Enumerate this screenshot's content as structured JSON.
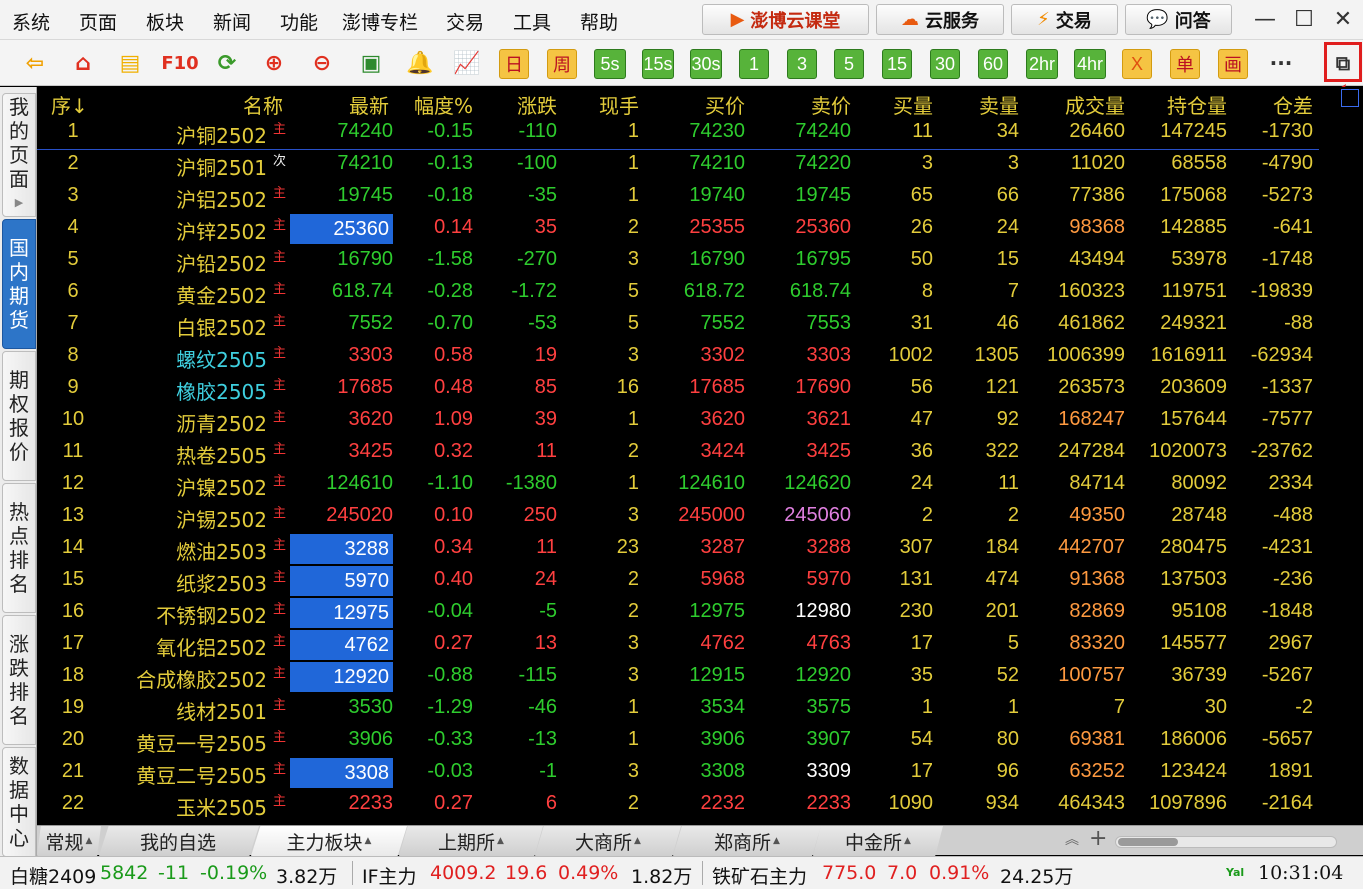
{
  "menu": [
    "系统",
    "页面",
    "板块",
    "新闻",
    "功能",
    "澎博专栏",
    "交易",
    "工具",
    "帮助"
  ],
  "top_buttons": [
    {
      "label": "澎博云课堂",
      "icon": "broadcast-icon"
    },
    {
      "label": "云服务",
      "icon": "cloud-icon"
    },
    {
      "label": "交易",
      "icon": "lightning-icon"
    },
    {
      "label": "问答",
      "icon": "chat-icon"
    }
  ],
  "window_controls": [
    "—",
    "☐",
    "✕"
  ],
  "toolbar": {
    "icons": [
      {
        "name": "back-arrow-icon",
        "glyph": "⇦",
        "color": "#f0a000"
      },
      {
        "name": "home-icon",
        "glyph": "⌂",
        "color": "#e03020"
      },
      {
        "name": "news-icon",
        "glyph": "▤",
        "color": "#f0b000"
      },
      {
        "name": "f10-icon",
        "glyph": "F10",
        "color": "#e03020"
      },
      {
        "name": "refresh-icon",
        "glyph": "⟳",
        "color": "#3a9a2a"
      },
      {
        "name": "zoom-in-icon",
        "glyph": "⊕",
        "color": "#e03020"
      },
      {
        "name": "zoom-out-icon",
        "glyph": "⊖",
        "color": "#e03020"
      },
      {
        "name": "windows-icon",
        "glyph": "▣",
        "color": "#2d8a2d"
      },
      {
        "name": "bell-icon",
        "glyph": "🔔",
        "color": "#f0a000"
      },
      {
        "name": "chart-up-icon",
        "glyph": "📈",
        "color": "#e03020"
      }
    ],
    "periods": [
      {
        "label": "日",
        "style": "yellow"
      },
      {
        "label": "周",
        "style": "yellow"
      },
      {
        "label": "5s",
        "style": "green"
      },
      {
        "label": "15s",
        "style": "green"
      },
      {
        "label": "30s",
        "style": "green"
      },
      {
        "label": "1",
        "style": "green"
      },
      {
        "label": "3",
        "style": "green"
      },
      {
        "label": "5",
        "style": "green"
      },
      {
        "label": "15",
        "style": "green"
      },
      {
        "label": "30",
        "style": "green"
      },
      {
        "label": "60",
        "style": "green"
      },
      {
        "label": "2hr",
        "style": "green"
      },
      {
        "label": "4hr",
        "style": "green"
      },
      {
        "label": "X",
        "style": "yellow"
      },
      {
        "label": "单",
        "style": "yellow"
      },
      {
        "label": "画",
        "style": "yellow"
      }
    ],
    "more": "···",
    "restore_icon": "restore-window-icon"
  },
  "sidebar_tabs": [
    {
      "label": "我的页面",
      "active": false,
      "arrow": true
    },
    {
      "label": "国内期货",
      "active": true,
      "arrow": false
    },
    {
      "label": "期权报价",
      "active": false,
      "arrow": false
    },
    {
      "label": "热点排名",
      "active": false,
      "arrow": false
    },
    {
      "label": "涨跌排名",
      "active": false,
      "arrow": false
    },
    {
      "label": "数据中心",
      "active": false,
      "arrow": false
    }
  ],
  "table": {
    "headers": [
      "序↓",
      "名称",
      "最新",
      "幅度%",
      "涨跌",
      "现手",
      "买价",
      "卖价",
      "买量",
      "卖量",
      "成交量",
      "持仓量",
      "仓差"
    ],
    "rows": [
      {
        "no": "1",
        "name": "沪铜2502",
        "tag": "主",
        "last": "74240",
        "pct": "-0.15",
        "chg": "-110",
        "hand": "1",
        "bid": "74230",
        "ask": "74240",
        "bidv": "11",
        "askv": "34",
        "vol": "26460",
        "oi": "147245",
        "oichg": "-1730",
        "dir": "down",
        "hl": false,
        "namec": "#e3cc3b",
        "askc": "#2ecc2e",
        "volc": "#e3cc3b"
      },
      {
        "no": "2",
        "name": "沪铜2501",
        "tag": "次",
        "last": "74210",
        "pct": "-0.13",
        "chg": "-100",
        "hand": "1",
        "bid": "74210",
        "ask": "74220",
        "bidv": "3",
        "askv": "3",
        "vol": "11020",
        "oi": "68558",
        "oichg": "-4790",
        "dir": "down",
        "hl": false,
        "namec": "#e3cc3b",
        "askc": "#2ecc2e",
        "volc": "#e3cc3b"
      },
      {
        "no": "3",
        "name": "沪铝2502",
        "tag": "主",
        "last": "19745",
        "pct": "-0.18",
        "chg": "-35",
        "hand": "1",
        "bid": "19740",
        "ask": "19745",
        "bidv": "65",
        "askv": "66",
        "vol": "77386",
        "oi": "175068",
        "oichg": "-5273",
        "dir": "down",
        "hl": false,
        "namec": "#e3cc3b",
        "askc": "#2ecc2e",
        "volc": "#e3cc3b"
      },
      {
        "no": "4",
        "name": "沪锌2502",
        "tag": "主",
        "last": "25360",
        "pct": "0.14",
        "chg": "35",
        "hand": "2",
        "bid": "25355",
        "ask": "25360",
        "bidv": "26",
        "askv": "24",
        "vol": "98368",
        "oi": "142885",
        "oichg": "-641",
        "dir": "up",
        "hl": true,
        "namec": "#e3cc3b",
        "askc": "#ff4040",
        "volc": "#ff9a40"
      },
      {
        "no": "5",
        "name": "沪铅2502",
        "tag": "主",
        "last": "16790",
        "pct": "-1.58",
        "chg": "-270",
        "hand": "3",
        "bid": "16790",
        "ask": "16795",
        "bidv": "50",
        "askv": "15",
        "vol": "43494",
        "oi": "53978",
        "oichg": "-1748",
        "dir": "down",
        "hl": false,
        "namec": "#e3cc3b",
        "askc": "#2ecc2e",
        "volc": "#e3cc3b"
      },
      {
        "no": "6",
        "name": "黄金2502",
        "tag": "主",
        "last": "618.74",
        "pct": "-0.28",
        "chg": "-1.72",
        "hand": "5",
        "bid": "618.72",
        "ask": "618.74",
        "bidv": "8",
        "askv": "7",
        "vol": "160323",
        "oi": "119751",
        "oichg": "-19839",
        "dir": "down",
        "hl": false,
        "namec": "#e3cc3b",
        "askc": "#2ecc2e",
        "volc": "#e3cc3b"
      },
      {
        "no": "7",
        "name": "白银2502",
        "tag": "主",
        "last": "7552",
        "pct": "-0.70",
        "chg": "-53",
        "hand": "5",
        "bid": "7552",
        "ask": "7553",
        "bidv": "31",
        "askv": "46",
        "vol": "461862",
        "oi": "249321",
        "oichg": "-88",
        "dir": "down",
        "hl": false,
        "namec": "#e3cc3b",
        "askc": "#2ecc2e",
        "volc": "#e3cc3b"
      },
      {
        "no": "8",
        "name": "螺纹2505",
        "tag": "主",
        "last": "3303",
        "pct": "0.58",
        "chg": "19",
        "hand": "3",
        "bid": "3302",
        "ask": "3303",
        "bidv": "1002",
        "askv": "1305",
        "vol": "1006399",
        "oi": "1616911",
        "oichg": "-62934",
        "dir": "up",
        "hl": false,
        "namec": "#3fd0e0",
        "askc": "#ff4040",
        "volc": "#e3cc3b"
      },
      {
        "no": "9",
        "name": "橡胶2505",
        "tag": "主",
        "last": "17685",
        "pct": "0.48",
        "chg": "85",
        "hand": "16",
        "bid": "17685",
        "ask": "17690",
        "bidv": "56",
        "askv": "121",
        "vol": "263573",
        "oi": "203609",
        "oichg": "-1337",
        "dir": "up",
        "hl": false,
        "namec": "#3fd0e0",
        "askc": "#ff4040",
        "volc": "#e3cc3b"
      },
      {
        "no": "10",
        "name": "沥青2502",
        "tag": "主",
        "last": "3620",
        "pct": "1.09",
        "chg": "39",
        "hand": "1",
        "bid": "3620",
        "ask": "3621",
        "bidv": "47",
        "askv": "92",
        "vol": "168247",
        "oi": "157644",
        "oichg": "-7577",
        "dir": "up",
        "hl": false,
        "namec": "#e3cc3b",
        "askc": "#ff4040",
        "volc": "#ff9a40"
      },
      {
        "no": "11",
        "name": "热卷2505",
        "tag": "主",
        "last": "3425",
        "pct": "0.32",
        "chg": "11",
        "hand": "2",
        "bid": "3424",
        "ask": "3425",
        "bidv": "36",
        "askv": "322",
        "vol": "247284",
        "oi": "1020073",
        "oichg": "-23762",
        "dir": "up",
        "hl": false,
        "namec": "#e3cc3b",
        "askc": "#ff4040",
        "volc": "#e3cc3b"
      },
      {
        "no": "12",
        "name": "沪镍2502",
        "tag": "主",
        "last": "124610",
        "pct": "-1.10",
        "chg": "-1380",
        "hand": "1",
        "bid": "124610",
        "ask": "124620",
        "bidv": "24",
        "askv": "11",
        "vol": "84714",
        "oi": "80092",
        "oichg": "2334",
        "dir": "down",
        "hl": false,
        "namec": "#e3cc3b",
        "askc": "#2ecc2e",
        "volc": "#e3cc3b"
      },
      {
        "no": "13",
        "name": "沪锡2502",
        "tag": "主",
        "last": "245020",
        "pct": "0.10",
        "chg": "250",
        "hand": "3",
        "bid": "245000",
        "ask": "245060",
        "bidv": "2",
        "askv": "2",
        "vol": "49350",
        "oi": "28748",
        "oichg": "-488",
        "dir": "up",
        "hl": false,
        "namec": "#e3cc3b",
        "askc": "#e080e0",
        "volc": "#ff9a40"
      },
      {
        "no": "14",
        "name": "燃油2503",
        "tag": "主",
        "last": "3288",
        "pct": "0.34",
        "chg": "11",
        "hand": "23",
        "bid": "3287",
        "ask": "3288",
        "bidv": "307",
        "askv": "184",
        "vol": "442707",
        "oi": "280475",
        "oichg": "-4231",
        "dir": "up",
        "hl": true,
        "namec": "#e3cc3b",
        "askc": "#ff4040",
        "volc": "#ff9a40"
      },
      {
        "no": "15",
        "name": "纸浆2503",
        "tag": "主",
        "last": "5970",
        "pct": "0.40",
        "chg": "24",
        "hand": "2",
        "bid": "5968",
        "ask": "5970",
        "bidv": "131",
        "askv": "474",
        "vol": "91368",
        "oi": "137503",
        "oichg": "-236",
        "dir": "up",
        "hl": true,
        "namec": "#e3cc3b",
        "askc": "#ff4040",
        "volc": "#ff9a40"
      },
      {
        "no": "16",
        "name": "不锈钢2502",
        "tag": "主",
        "last": "12975",
        "pct": "-0.04",
        "chg": "-5",
        "hand": "2",
        "bid": "12975",
        "ask": "12980",
        "bidv": "230",
        "askv": "201",
        "vol": "82869",
        "oi": "95108",
        "oichg": "-1848",
        "dir": "down",
        "hl": true,
        "namec": "#e3cc3b",
        "askc": "#ffffff",
        "volc": "#ff9a40"
      },
      {
        "no": "17",
        "name": "氧化铝2502",
        "tag": "主",
        "last": "4762",
        "pct": "0.27",
        "chg": "13",
        "hand": "3",
        "bid": "4762",
        "ask": "4763",
        "bidv": "17",
        "askv": "5",
        "vol": "83320",
        "oi": "145577",
        "oichg": "2967",
        "dir": "up",
        "hl": true,
        "namec": "#e3cc3b",
        "askc": "#ff4040",
        "volc": "#ff9a40"
      },
      {
        "no": "18",
        "name": "合成橡胶2502",
        "tag": "主",
        "last": "12920",
        "pct": "-0.88",
        "chg": "-115",
        "hand": "3",
        "bid": "12915",
        "ask": "12920",
        "bidv": "35",
        "askv": "52",
        "vol": "100757",
        "oi": "36739",
        "oichg": "-5267",
        "dir": "down",
        "hl": true,
        "namec": "#e3cc3b",
        "askc": "#2ecc2e",
        "volc": "#ff9a40"
      },
      {
        "no": "19",
        "name": "线材2501",
        "tag": "主",
        "last": "3530",
        "pct": "-1.29",
        "chg": "-46",
        "hand": "1",
        "bid": "3534",
        "ask": "3575",
        "bidv": "1",
        "askv": "1",
        "vol": "7",
        "oi": "30",
        "oichg": "-2",
        "dir": "down",
        "hl": false,
        "namec": "#e3cc3b",
        "askc": "#2ecc2e",
        "volc": "#e3cc3b"
      },
      {
        "no": "20",
        "name": "黄豆一号2505",
        "tag": "主",
        "last": "3906",
        "pct": "-0.33",
        "chg": "-13",
        "hand": "1",
        "bid": "3906",
        "ask": "3907",
        "bidv": "54",
        "askv": "80",
        "vol": "69381",
        "oi": "186006",
        "oichg": "-5657",
        "dir": "down",
        "hl": false,
        "namec": "#e3cc3b",
        "askc": "#2ecc2e",
        "volc": "#ff9a40"
      },
      {
        "no": "21",
        "name": "黄豆二号2505",
        "tag": "主",
        "last": "3308",
        "pct": "-0.03",
        "chg": "-1",
        "hand": "3",
        "bid": "3308",
        "ask": "3309",
        "bidv": "17",
        "askv": "96",
        "vol": "63252",
        "oi": "123424",
        "oichg": "1891",
        "dir": "down",
        "hl": true,
        "namec": "#e3cc3b",
        "askc": "#ffffff",
        "volc": "#ff9a40"
      },
      {
        "no": "22",
        "name": "玉米2505",
        "tag": "主",
        "last": "2233",
        "pct": "0.27",
        "chg": "6",
        "hand": "2",
        "bid": "2232",
        "ask": "2233",
        "bidv": "1090",
        "askv": "934",
        "vol": "464343",
        "oi": "1097896",
        "oichg": "-2164",
        "dir": "up",
        "hl": false,
        "namec": "#e3cc3b",
        "askc": "#ff4040",
        "volc": "#e3cc3b"
      }
    ]
  },
  "bottom_tabs": [
    {
      "label": "常规",
      "arrow": "▲",
      "active": false
    },
    {
      "label": "我的自选",
      "arrow": "",
      "active": false
    },
    {
      "label": "主力板块",
      "arrow": "▲",
      "active": true
    },
    {
      "label": "上期所",
      "arrow": "▲",
      "active": false
    },
    {
      "label": "大商所",
      "arrow": "▲",
      "active": false
    },
    {
      "label": "郑商所",
      "arrow": "▲",
      "active": false
    },
    {
      "label": "中金所",
      "arrow": "▲",
      "active": false
    }
  ],
  "statusbar": {
    "item1": {
      "name": "白糖2409",
      "price": "5842",
      "chg": "-11",
      "pct": "-0.19%",
      "vol": "3.82万"
    },
    "item2": {
      "name": "IF主力",
      "price": "4009.2",
      "chg": "19.6",
      "pct": "0.49%",
      "vol": "1.82万"
    },
    "item3": {
      "name": "铁矿石主力",
      "price": "775.0",
      "chg": "7.0",
      "pct": "0.91%",
      "vol": "24.25万"
    },
    "signal": "Yal",
    "time": "10:31:04"
  },
  "colors": {
    "up": "#ff4040",
    "down": "#2ecc2e",
    "neutral": "#e3cc3b",
    "header": "#e3cc3b",
    "highlight": "#2067d9",
    "callout": "#e01e1e"
  }
}
